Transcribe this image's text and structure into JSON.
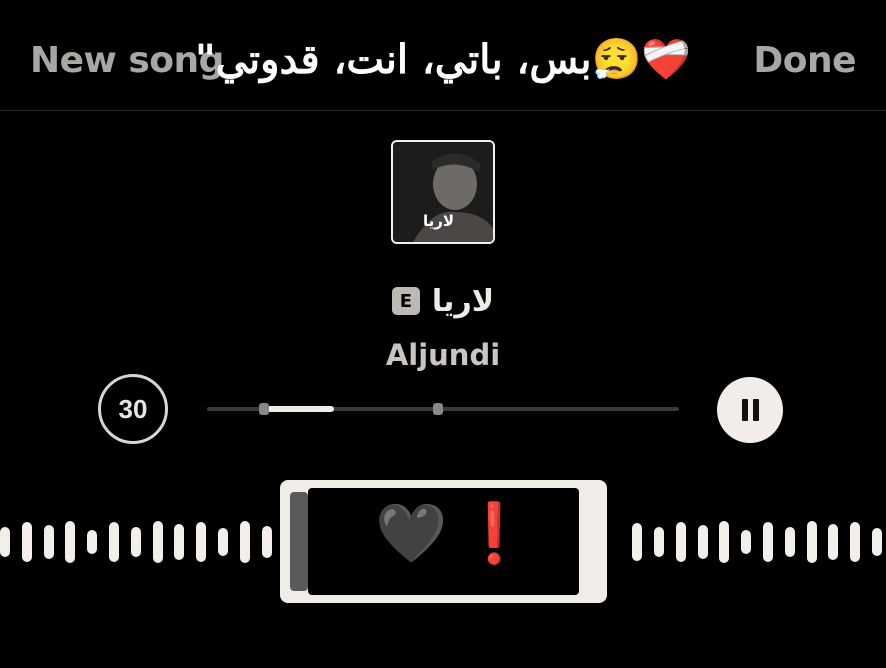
{
  "header": {
    "new_song_label": "New song",
    "done_label": "Done",
    "caption": "\"بس، باتي، انت، قدوتي😮‍💨❤️‍🩹"
  },
  "track": {
    "cover_label": "لاريا",
    "title": "لاريا",
    "explicit_badge": "E",
    "artist": "Aljundi"
  },
  "controls": {
    "skip_label": "30",
    "progress": 0.12,
    "clip_start": 0.12,
    "clip_end": 0.49
  },
  "clip_selector": {
    "heart": "🖤",
    "exclamation": "❗"
  },
  "colors": {
    "background": "#000000",
    "accent": "#f0ede8",
    "muted": "#a9a7a3"
  }
}
